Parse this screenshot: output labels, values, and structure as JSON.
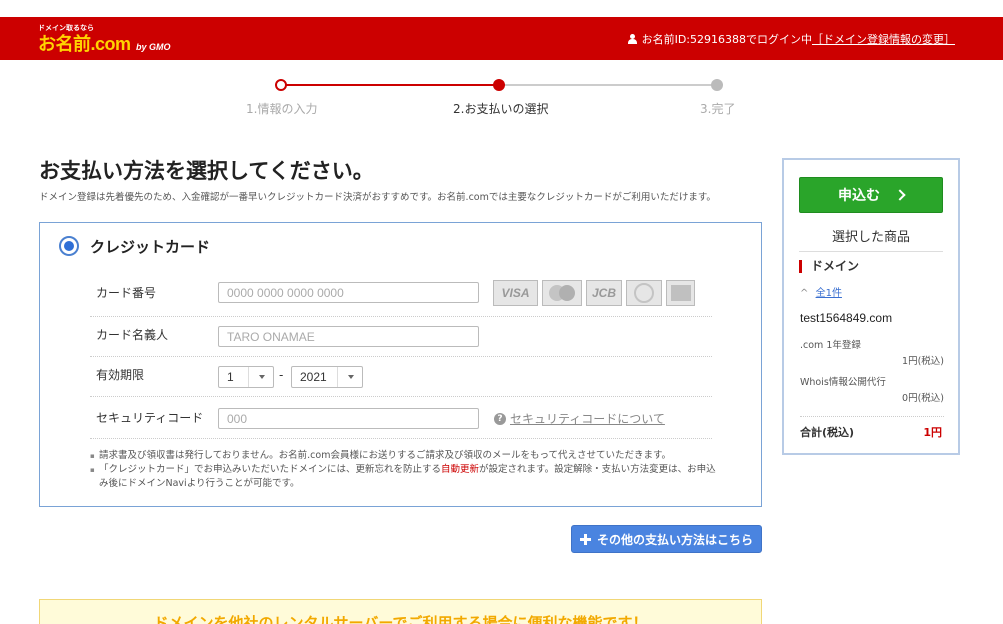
{
  "header": {
    "logo_tagline": "ドメイン取るなら",
    "logo_text": "お名前.com",
    "logo_company": "by GMO",
    "user_status": "お名前ID:52916388でログイン中",
    "change_link": "［ドメイン登録情報の変更］",
    "bg_color": "#cc0000"
  },
  "steps": [
    {
      "label": "1.情報の入力",
      "state": "done"
    },
    {
      "label": "2.お支払いの選択",
      "state": "current"
    },
    {
      "label": "3.完了",
      "state": "upcoming"
    }
  ],
  "main": {
    "title": "お支払い方法を選択してください。",
    "description": "ドメイン登録は先着優先のため、入金確認が一番早いクレジットカード決済がおすすめです。お名前.comでは主要なクレジットカードがご利用いただけます。"
  },
  "credit_card": {
    "title": "クレジットカード",
    "selected": true,
    "card_number": {
      "label": "カード番号",
      "placeholder": "0000 0000 0000 0000"
    },
    "brands": [
      "VISA",
      "MasterCard",
      "JCB",
      "Diners Club",
      "American Express"
    ],
    "brand_visa": "VISA",
    "brand_jcb": "JCB",
    "card_name": {
      "label": "カード名義人",
      "placeholder": "TARO ONAMAE"
    },
    "expiry": {
      "label": "有効期限",
      "month": "1",
      "separator": "-",
      "year": "2021"
    },
    "security": {
      "label": "セキュリティコード",
      "placeholder": "000",
      "help_link": "セキュリティコードについて"
    },
    "notes": {
      "note1": "請求書及び領収書は発行しておりません。お名前.com会員様にお送りするご請求及び領収のメールをもって代えさせていただきます。",
      "note2_prefix": "「クレジットカード」でお申込みいただいたドメインには、更新忘れを防止する",
      "note2_highlight": "自動更新",
      "note2_suffix": "が設定されます。設定解除・支払い方法変更は、お申込み後にドメインNaviより行うことが可能です。"
    }
  },
  "other_payment_button": "その他の支払い方法はこちら",
  "promo_text": "ドメインを他社のレンタルサーバーでご利用する場合に便利な機能です！",
  "sidebar": {
    "apply_button": "申込む",
    "heading": "選択した商品",
    "category": "ドメイン",
    "count_link": "全1件",
    "domain": "test1564849.com",
    "items": [
      {
        "name": ".com 1年登録",
        "price": "1円(税込)"
      },
      {
        "name": "Whois情報公開代行",
        "price": "0円(税込)"
      }
    ],
    "total_label": "合計(税込)",
    "total_value": "1円"
  },
  "colors": {
    "brand_red": "#cc0000",
    "apply_green": "#2aa52a",
    "button_blue": "#4a84e0",
    "radio_blue": "#2f6fd6"
  }
}
